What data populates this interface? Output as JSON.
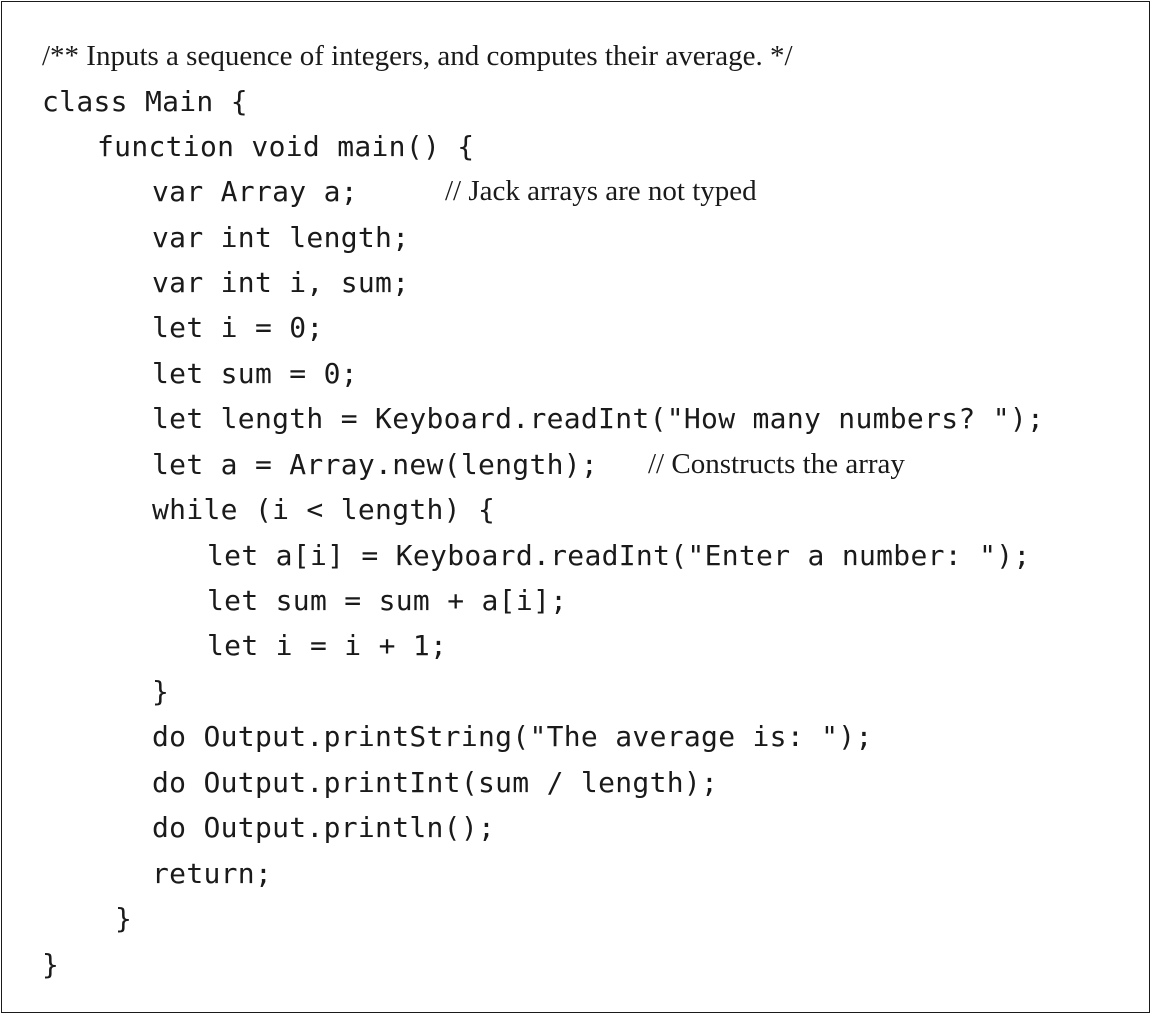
{
  "code_listing": {
    "lines": [
      {
        "indent": 0,
        "code": "",
        "comment": "/** Inputs a sequence of integers, and computes their average. */"
      },
      {
        "indent": 0,
        "code": "class Main {",
        "comment": ""
      },
      {
        "indent": 1,
        "code": "function void main() {",
        "comment": ""
      },
      {
        "indent": 2,
        "code": "var Array a;",
        "comment": "// Jack arrays are not typed"
      },
      {
        "indent": 2,
        "code": "var int length;",
        "comment": ""
      },
      {
        "indent": 2,
        "code": "var int i, sum;",
        "comment": ""
      },
      {
        "indent": 2,
        "code": "let i = 0;",
        "comment": ""
      },
      {
        "indent": 2,
        "code": "let sum = 0;",
        "comment": ""
      },
      {
        "indent": 2,
        "code": "let length = Keyboard.readInt(\"How many numbers? \");",
        "comment": ""
      },
      {
        "indent": 2,
        "code": "let a = Array.new(length);",
        "comment": "// Constructs the array"
      },
      {
        "indent": 2,
        "code": "while (i < length) {",
        "comment": ""
      },
      {
        "indent": 3,
        "code": "let a[i] = Keyboard.readInt(\"Enter a number: \");",
        "comment": ""
      },
      {
        "indent": 3,
        "code": "let sum = sum + a[i];",
        "comment": ""
      },
      {
        "indent": 3,
        "code": "let i = i + 1;",
        "comment": ""
      },
      {
        "indent": 2,
        "code": "}",
        "comment": ""
      },
      {
        "indent": 2,
        "code": "do Output.printString(\"The average is: \");",
        "comment": ""
      },
      {
        "indent": 2,
        "code": "do Output.printInt(sum / length);",
        "comment": ""
      },
      {
        "indent": 2,
        "code": "do Output.println();",
        "comment": ""
      },
      {
        "indent": 2,
        "code": "return;",
        "comment": ""
      },
      {
        "indent": 1,
        "code": "}",
        "comment": ""
      },
      {
        "indent": 0,
        "code": "}",
        "comment": ""
      }
    ]
  }
}
